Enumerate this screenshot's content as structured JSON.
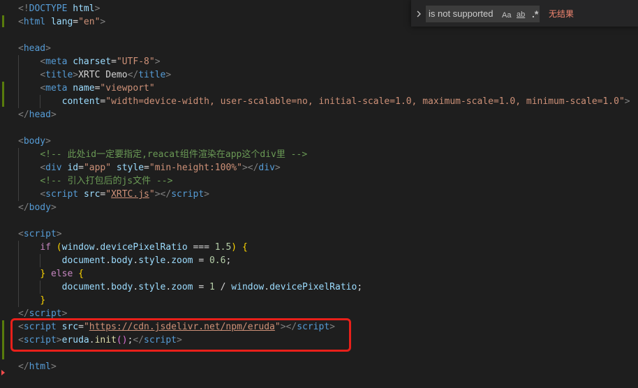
{
  "find_widget": {
    "query": "is not supported",
    "match_case_label": "Aa",
    "whole_word_label": "ab",
    "regex_label": ".*",
    "result_text": "无结果"
  },
  "colors": {
    "background": "#1e1e1e",
    "highlight_box": "#e8201a",
    "git_added": "#587c0c",
    "git_deleted": "#f14c4c",
    "no_result": "#f48771"
  },
  "code_lines": [
    [
      [
        "t-punc",
        "<!"
      ],
      [
        "t-tag",
        "DOCTYPE"
      ],
      [
        "t-text",
        " "
      ],
      [
        "t-attr",
        "html"
      ],
      [
        "t-punc",
        ">"
      ]
    ],
    [
      [
        "t-punc",
        "<"
      ],
      [
        "t-tag",
        "html"
      ],
      [
        "t-text",
        " "
      ],
      [
        "t-attr",
        "lang"
      ],
      [
        "t-text",
        "="
      ],
      [
        "t-str",
        "\"en\""
      ],
      [
        "t-punc",
        ">"
      ]
    ],
    [],
    [
      [
        "t-punc",
        "<"
      ],
      [
        "t-tag",
        "head"
      ],
      [
        "t-punc",
        ">"
      ]
    ],
    [
      [
        "t-text",
        "    "
      ],
      [
        "t-punc",
        "<"
      ],
      [
        "t-tag",
        "meta"
      ],
      [
        "t-text",
        " "
      ],
      [
        "t-attr",
        "charset"
      ],
      [
        "t-text",
        "="
      ],
      [
        "t-str",
        "\"UTF-8\""
      ],
      [
        "t-punc",
        ">"
      ]
    ],
    [
      [
        "t-text",
        "    "
      ],
      [
        "t-punc",
        "<"
      ],
      [
        "t-tag",
        "title"
      ],
      [
        "t-punc",
        ">"
      ],
      [
        "t-text",
        "XRTC Demo"
      ],
      [
        "t-punc",
        "</"
      ],
      [
        "t-tag",
        "title"
      ],
      [
        "t-punc",
        ">"
      ]
    ],
    [
      [
        "t-text",
        "    "
      ],
      [
        "t-punc",
        "<"
      ],
      [
        "t-tag",
        "meta"
      ],
      [
        "t-text",
        " "
      ],
      [
        "t-attr",
        "name"
      ],
      [
        "t-text",
        "="
      ],
      [
        "t-str",
        "\"viewport\""
      ]
    ],
    [
      [
        "t-text",
        "        "
      ],
      [
        "t-attr",
        "content"
      ],
      [
        "t-text",
        "="
      ],
      [
        "t-str",
        "\"width=device-width, user-scalable=no, initial-scale=1.0, maximum-scale=1.0, minimum-scale=1.0\""
      ],
      [
        "t-punc",
        ">"
      ]
    ],
    [
      [
        "t-punc",
        "</"
      ],
      [
        "t-tag",
        "head"
      ],
      [
        "t-punc",
        ">"
      ]
    ],
    [],
    [
      [
        "t-punc",
        "<"
      ],
      [
        "t-tag",
        "body"
      ],
      [
        "t-punc",
        ">"
      ]
    ],
    [
      [
        "t-text",
        "    "
      ],
      [
        "t-cmt",
        "<!-- 此处id一定要指定,reacat组件渲染在app这个div里 -->"
      ]
    ],
    [
      [
        "t-text",
        "    "
      ],
      [
        "t-punc",
        "<"
      ],
      [
        "t-tag",
        "div"
      ],
      [
        "t-text",
        " "
      ],
      [
        "t-attr",
        "id"
      ],
      [
        "t-text",
        "="
      ],
      [
        "t-str",
        "\"app\""
      ],
      [
        "t-text",
        " "
      ],
      [
        "t-attr",
        "style"
      ],
      [
        "t-text",
        "="
      ],
      [
        "t-str",
        "\"min-height:100%\""
      ],
      [
        "t-punc",
        "></"
      ],
      [
        "t-tag",
        "div"
      ],
      [
        "t-punc",
        ">"
      ]
    ],
    [
      [
        "t-text",
        "    "
      ],
      [
        "t-cmt",
        "<!-- 引入打包后的js文件 -->"
      ]
    ],
    [
      [
        "t-text",
        "    "
      ],
      [
        "t-punc",
        "<"
      ],
      [
        "t-tag",
        "script"
      ],
      [
        "t-text",
        " "
      ],
      [
        "t-attr",
        "src"
      ],
      [
        "t-text",
        "="
      ],
      [
        "t-str",
        "\""
      ],
      [
        "t-link",
        "XRTC.js"
      ],
      [
        "t-str",
        "\""
      ],
      [
        "t-punc",
        "></"
      ],
      [
        "t-tag",
        "script"
      ],
      [
        "t-punc",
        ">"
      ]
    ],
    [
      [
        "t-punc",
        "</"
      ],
      [
        "t-tag",
        "body"
      ],
      [
        "t-punc",
        ">"
      ]
    ],
    [],
    [
      [
        "t-punc",
        "<"
      ],
      [
        "t-tag",
        "script"
      ],
      [
        "t-punc",
        ">"
      ]
    ],
    [
      [
        "t-text",
        "    "
      ],
      [
        "t-kw",
        "if"
      ],
      [
        "t-text",
        " "
      ],
      [
        "t-brace",
        "("
      ],
      [
        "t-var",
        "window"
      ],
      [
        "t-op",
        "."
      ],
      [
        "t-var",
        "devicePixelRatio"
      ],
      [
        "t-op",
        " === "
      ],
      [
        "t-num",
        "1.5"
      ],
      [
        "t-brace",
        ")"
      ],
      [
        "t-text",
        " "
      ],
      [
        "t-brace",
        "{"
      ]
    ],
    [
      [
        "t-text",
        "        "
      ],
      [
        "t-var",
        "document"
      ],
      [
        "t-op",
        "."
      ],
      [
        "t-var",
        "body"
      ],
      [
        "t-op",
        "."
      ],
      [
        "t-var",
        "style"
      ],
      [
        "t-op",
        "."
      ],
      [
        "t-var",
        "zoom"
      ],
      [
        "t-op",
        " = "
      ],
      [
        "t-num",
        "0.6"
      ],
      [
        "t-op",
        ";"
      ]
    ],
    [
      [
        "t-text",
        "    "
      ],
      [
        "t-brace",
        "}"
      ],
      [
        "t-text",
        " "
      ],
      [
        "t-kw",
        "else"
      ],
      [
        "t-text",
        " "
      ],
      [
        "t-brace",
        "{"
      ]
    ],
    [
      [
        "t-text",
        "        "
      ],
      [
        "t-var",
        "document"
      ],
      [
        "t-op",
        "."
      ],
      [
        "t-var",
        "body"
      ],
      [
        "t-op",
        "."
      ],
      [
        "t-var",
        "style"
      ],
      [
        "t-op",
        "."
      ],
      [
        "t-var",
        "zoom"
      ],
      [
        "t-op",
        " = "
      ],
      [
        "t-num",
        "1"
      ],
      [
        "t-op",
        " / "
      ],
      [
        "t-var",
        "window"
      ],
      [
        "t-op",
        "."
      ],
      [
        "t-var",
        "devicePixelRatio"
      ],
      [
        "t-op",
        ";"
      ]
    ],
    [
      [
        "t-text",
        "    "
      ],
      [
        "t-brace",
        "}"
      ]
    ],
    [
      [
        "t-punc",
        "</"
      ],
      [
        "t-tag",
        "script"
      ],
      [
        "t-punc",
        ">"
      ]
    ],
    [
      [
        "t-punc",
        "<"
      ],
      [
        "t-tag",
        "script"
      ],
      [
        "t-text",
        " "
      ],
      [
        "t-attr",
        "src"
      ],
      [
        "t-text",
        "="
      ],
      [
        "t-str",
        "\""
      ],
      [
        "t-link",
        "https://cdn.jsdelivr.net/npm/eruda"
      ],
      [
        "t-str",
        "\""
      ],
      [
        "t-punc",
        "></"
      ],
      [
        "t-tag",
        "script"
      ],
      [
        "t-punc",
        ">"
      ]
    ],
    [
      [
        "t-punc",
        "<"
      ],
      [
        "t-tag",
        "script"
      ],
      [
        "t-punc",
        ">"
      ],
      [
        "t-var",
        "eruda"
      ],
      [
        "t-op",
        "."
      ],
      [
        "t-fn",
        "init"
      ],
      [
        "t-paren",
        "()"
      ],
      [
        "t-op",
        ";"
      ],
      [
        "t-punc",
        "</"
      ],
      [
        "t-tag",
        "script"
      ],
      [
        "t-punc",
        ">"
      ]
    ],
    [],
    [
      [
        "t-punc",
        "</"
      ],
      [
        "t-tag",
        "html"
      ],
      [
        "t-punc",
        ">"
      ]
    ]
  ]
}
